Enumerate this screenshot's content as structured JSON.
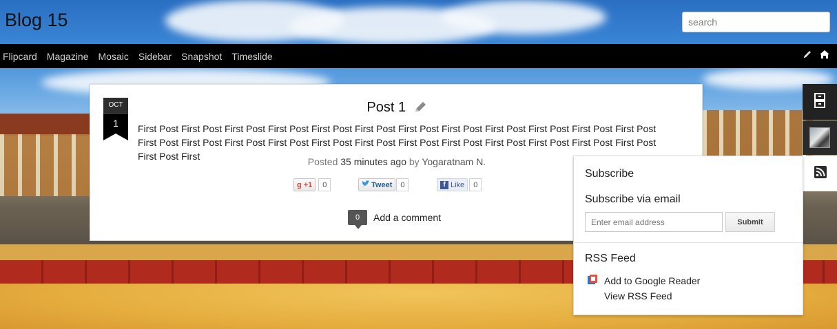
{
  "header": {
    "site_title": "t Blog 15",
    "search_placeholder": "search"
  },
  "nav": {
    "items": [
      "Flipcard",
      "Magazine",
      "Mosaic",
      "Sidebar",
      "Snapshot",
      "Timeslide"
    ],
    "icons": [
      "pencil-icon",
      "home-icon"
    ]
  },
  "post": {
    "month": "OCT",
    "day": "1",
    "title": "Post 1",
    "body": "First Post First Post First Post First Post First Post First Post First Post First Post First Post First Post First Post First Post First Post First Post First Post First Post First Post First Post First Post First Post First Post First Post First Post First Post First Post First",
    "meta": {
      "posted": "Posted",
      "time": "35 minutes ago",
      "by": "by",
      "author": "Yogaratnam N."
    },
    "share": {
      "gplus_label": "+1",
      "gplus_count": "0",
      "tweet_label": "Tweet",
      "tweet_count": "0",
      "like_label": "Like",
      "like_count": "0"
    },
    "comments": {
      "count": "0",
      "label": "Add a comment"
    }
  },
  "sidebar_tabs": {
    "icons": [
      "archive-icon",
      "avatar",
      "rss-icon"
    ]
  },
  "subscribe": {
    "title": "Subscribe",
    "email_title": "Subscribe via email",
    "email_placeholder": "Enter email address",
    "submit_label": "Submit",
    "rss_title": "RSS Feed",
    "google_reader_label": "Add to Google Reader",
    "rss_link_label": "View RSS Feed"
  },
  "colors": {
    "navbar": "#000000",
    "accent": "#111111"
  }
}
